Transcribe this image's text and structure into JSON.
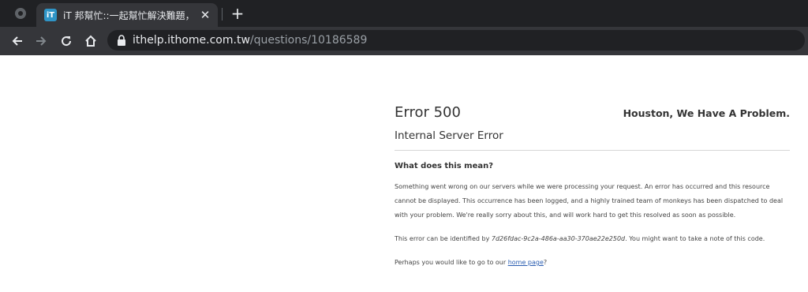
{
  "browser": {
    "tab": {
      "favicon_text": "iT",
      "title": "iT 邦幫忙::一起幫忙解決難題，拯",
      "close_glyph": "✕"
    },
    "newtab_glyph": "+",
    "address": {
      "host": "ithelp.ithome.com.tw",
      "path": "/questions/10186589"
    },
    "accent_color": "#35363a"
  },
  "error_page": {
    "code": "Error 500",
    "tagline": "Houston, We Have A Problem.",
    "subtitle": "Internal Server Error",
    "question": "What does this mean?",
    "paragraph": "Something went wrong on our servers while we were processing your request. An error has occurred and this resource cannot be displayed. This occurrence has been logged, and a highly trained team of monkeys has been dispatched to deal with your problem. We're really sorry about this, and will work hard to get this resolved as soon as possible.",
    "id_prefix": "This error can be identified by ",
    "id_value": "7d26fdac-9c2a-486a-aa30-370ae22e250d",
    "id_suffix": ". You might want to take a note of this code.",
    "home_prefix": "Perhaps you would like to go to our ",
    "home_link": "home page",
    "home_suffix": "?"
  }
}
